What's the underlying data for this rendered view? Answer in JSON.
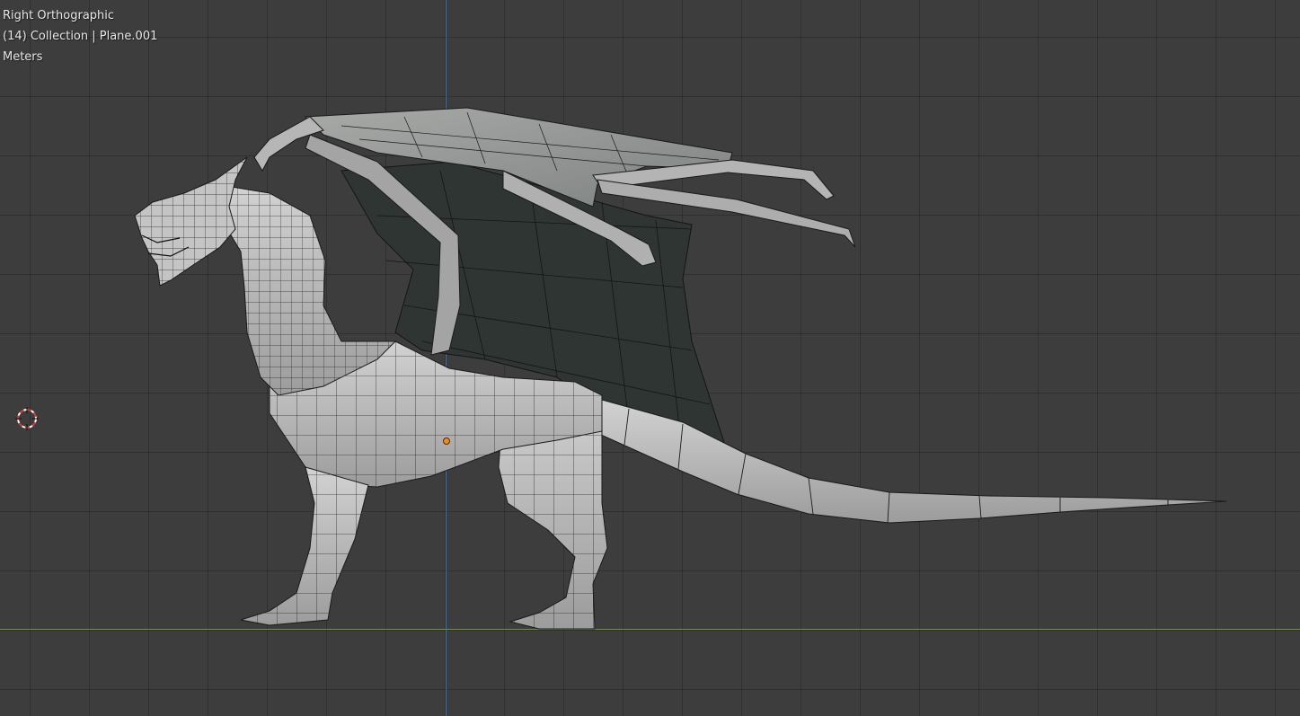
{
  "viewport": {
    "view_name": "Right Orthographic",
    "collection_info": "(14) Collection | Plane.001",
    "units": "Meters"
  },
  "colors": {
    "background": "#3d3d3d",
    "axis_y": "#3a6fb8",
    "axis_z": "#6b9b2f",
    "mesh_surface": "#bdbdbd",
    "wing_membrane": "#2f3533",
    "wireframe": "#1a1a1a",
    "origin_dot": "#f08a24"
  },
  "icons": {
    "cursor": "3d-cursor-icon",
    "origin": "object-origin-icon"
  }
}
